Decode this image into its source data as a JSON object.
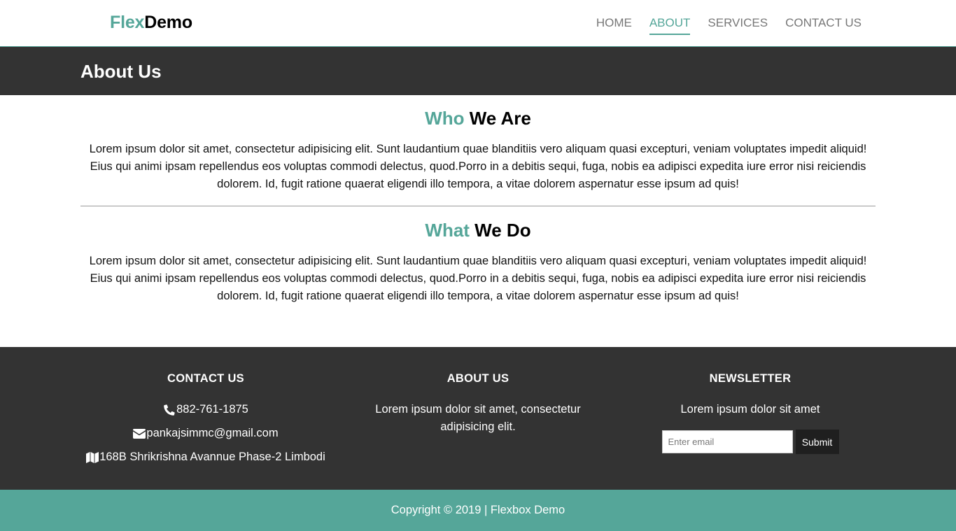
{
  "brand": {
    "first": "Flex",
    "second": "Demo",
    "accent_color": "#55a699"
  },
  "nav": {
    "items": [
      {
        "label": "HOME"
      },
      {
        "label": "ABOUT",
        "active": true
      },
      {
        "label": "SERVICES"
      },
      {
        "label": "CONTACT US"
      }
    ]
  },
  "page_header": {
    "title": "About Us"
  },
  "sections": [
    {
      "title_accent": "Who",
      "title_rest": " We Are",
      "body": "Lorem ipsum dolor sit amet, consectetur adipisicing elit. Sunt laudantium quae blanditiis vero aliquam quasi excepturi, veniam voluptates impedit aliquid! Eius qui animi ipsam repellendus eos voluptas commodi delectus, quod.Porro in a debitis sequi, fuga, nobis ea adipisci expedita iure error nisi reiciendis dolorem. Id, fugit ratione quaerat eligendi illo tempora, a vitae dolorem aspernatur esse ipsum ad quis!"
    },
    {
      "title_accent": "What",
      "title_rest": " We Do",
      "body": "Lorem ipsum dolor sit amet, consectetur adipisicing elit. Sunt laudantium quae blanditiis vero aliquam quasi excepturi, veniam voluptates impedit aliquid! Eius qui animi ipsam repellendus eos voluptas commodi delectus, quod.Porro in a debitis sequi, fuga, nobis ea adipisci expedita iure error nisi reiciendis dolorem. Id, fugit ratione quaerat eligendi illo tempora, a vitae dolorem aspernatur esse ipsum ad quis!"
    }
  ],
  "footer": {
    "contact": {
      "heading": "CONTACT US",
      "phone": "882-761-1875",
      "email": "pankajsimmc@gmail.com",
      "address": "168B Shrikrishna Avannue Phase-2 Limbodi",
      "icons": [
        "phone-icon",
        "envelope-icon",
        "map-icon"
      ]
    },
    "about": {
      "heading": "ABOUT US",
      "text": "Lorem ipsum dolor sit amet, consectetur adipisicing elit."
    },
    "newsletter": {
      "heading": "NEWSLETTER",
      "text": "Lorem ipsum dolor sit amet",
      "email_placeholder": "Enter email",
      "email_value": "",
      "submit_label": "Submit"
    }
  },
  "copyright": "Copyright © 2019 | Flexbox Demo",
  "colors": {
    "dark": "#333333",
    "accent": "#55a699",
    "button": "#1f1f1f"
  }
}
